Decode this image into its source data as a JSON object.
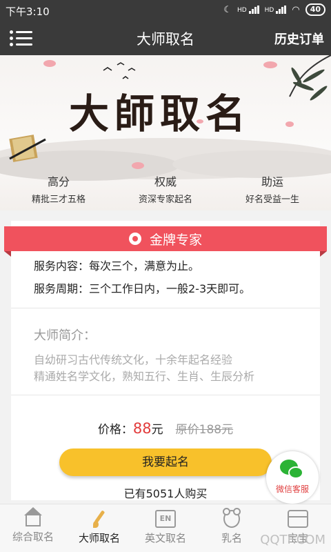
{
  "status_bar": {
    "time": "下午3:10",
    "battery": "40",
    "network_1": "HD",
    "network_2": "HD"
  },
  "nav": {
    "title": "大师取名",
    "right_action": "历史订单"
  },
  "banner": {
    "title": "大師取名",
    "features": [
      {
        "title": "高分",
        "subtitle": "精批三才五格"
      },
      {
        "title": "权威",
        "subtitle": "资深专家起名"
      },
      {
        "title": "助运",
        "subtitle": "好名受益一生"
      }
    ]
  },
  "card": {
    "badge": "金牌专家",
    "service_content": "服务内容：每次三个，满意为止。",
    "service_period": "服务周期：三个工作日内，一般2-3天即可。",
    "intro_title": "大师简介：",
    "intro_lines": [
      "自幼研习古代传统文化，十余年起名经验",
      "精通姓名学文化，熟知五行、生肖、生辰分析"
    ],
    "price_label": "价格：",
    "price_value": "88",
    "price_unit": "元",
    "original_price": "原价188元",
    "buy_button": "我要起名",
    "buyers": "已有5051人购买"
  },
  "float_button": {
    "label": "微信客服"
  },
  "tabs": [
    {
      "label": "综合取名",
      "icon": "home-icon",
      "active": false
    },
    {
      "label": "大师取名",
      "icon": "brush-icon",
      "active": true
    },
    {
      "label": "英文取名",
      "icon": "en-icon",
      "icon_text": "EN",
      "active": false
    },
    {
      "label": "乳名",
      "icon": "bear-icon",
      "active": false
    },
    {
      "label": "宝宝",
      "icon": "box-icon",
      "active": false
    }
  ],
  "watermark": "QQTF.COM",
  "colors": {
    "header_bg": "#3a3a3a",
    "ribbon": "#f0525d",
    "button": "#f8c12b",
    "price": "#e23b3b",
    "wechat_green": "#2bb335"
  }
}
